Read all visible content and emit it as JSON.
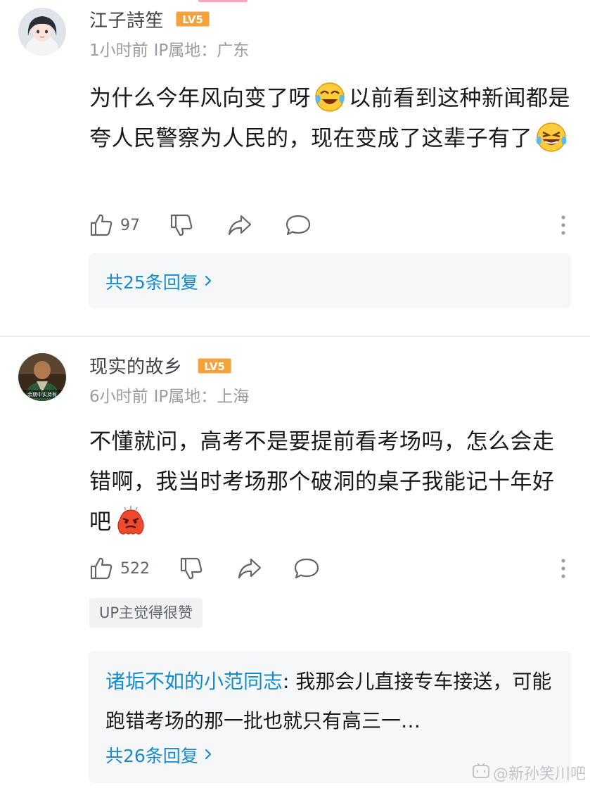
{
  "comments": [
    {
      "username": "江子詩笙",
      "level_badge": "LV5",
      "time": "1小时前",
      "ip_label": "IP属地：",
      "ip_location": "广东",
      "text_parts": [
        "为什么今年风向变了呀",
        "以前看到这种新闻都是夸人民警察为人民的，现在变成了这辈子有了"
      ],
      "emojis": [
        "tears-of-joy-emoji",
        "laughing-emoji"
      ],
      "likes": "97",
      "reply_total": "共25条回复"
    },
    {
      "username": "现实的故乡",
      "level_badge": "LV5",
      "avatar_caption": "余期中实持有",
      "time": "6小时前",
      "ip_label": "IP属地：",
      "ip_location": "上海",
      "text": "不懂就问，高考不是要提前看考场吗，怎么会走错啊，我当时考场那个破洞的桌子我能记十年好吧",
      "emojis": [
        "angry-blob-emoji"
      ],
      "likes": "522",
      "up_badge": "UP主觉得很赞",
      "reply_preview_author": "诸垢不如的小范同志",
      "reply_preview_text": ": 我那会儿直接专车接送，可能跑错考场的那一批也就只有高三一…",
      "reply_total": "共26条回复"
    }
  ],
  "watermark": "@新孙笑川吧",
  "colors": {
    "link_blue": "#178bcf",
    "level_orange": "#f6a23b",
    "meta_gray": "#9a9ca4",
    "reply_bg": "#f6f7f9"
  }
}
